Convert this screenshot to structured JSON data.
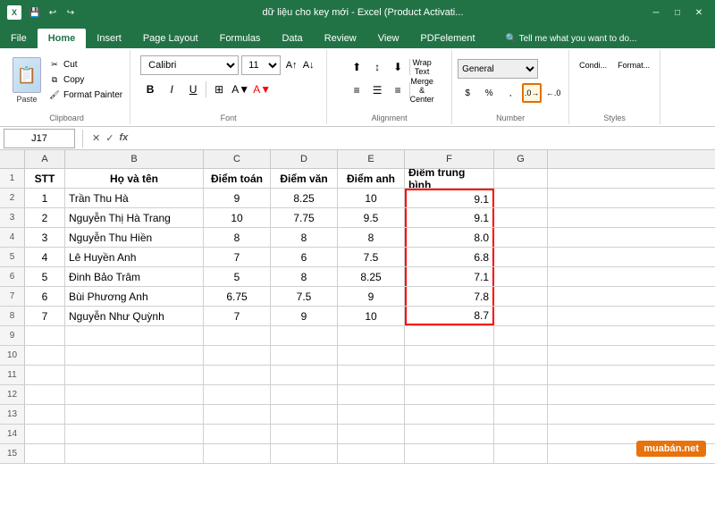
{
  "titlebar": {
    "title": "dữ liệu cho key mới - Excel (Product Activati...",
    "save_icon": "💾",
    "undo_icon": "↩",
    "redo_icon": "↪"
  },
  "ribbon": {
    "tabs": [
      "File",
      "Home",
      "Insert",
      "Page Layout",
      "Formulas",
      "Data",
      "Review",
      "View",
      "PDFelement"
    ],
    "active_tab": "Home",
    "clipboard_group": "Clipboard",
    "font_group": "Font",
    "alignment_group": "Alignment",
    "number_group": "Number",
    "styles_group": "Styles"
  },
  "toolbar": {
    "paste_label": "Paste",
    "cut_label": "Cut",
    "copy_label": "Copy",
    "format_painter_label": "Format Painter",
    "font_name": "Calibri",
    "font_size": "11",
    "wrap_text": "Wrap Text",
    "merge_center": "Merge & Center",
    "number_format": "General",
    "bold": "B",
    "italic": "I",
    "underline": "U"
  },
  "formula_bar": {
    "cell_ref": "J17",
    "formula": ""
  },
  "columns": {
    "headers": [
      "A",
      "B",
      "C",
      "D",
      "E",
      "F",
      "G"
    ]
  },
  "sheet": {
    "header_row": {
      "stt": "STT",
      "ho_va_ten": "Họ và tên",
      "diem_toan": "Điểm toán",
      "diem_van": "Điểm văn",
      "diem_anh": "Điểm anh",
      "diem_tb": "Điểm trung bình"
    },
    "rows": [
      {
        "num": 2,
        "stt": 1,
        "name": "Trần Thu Hà",
        "toan": 9,
        "van": 8.25,
        "anh": 10,
        "tb": 9.1
      },
      {
        "num": 3,
        "stt": 2,
        "name": "Nguyễn Thị Hà Trang",
        "toan": 10,
        "van": 7.75,
        "anh": 9.5,
        "tb": 9.1
      },
      {
        "num": 4,
        "stt": 3,
        "name": "Nguyễn Thu Hiền",
        "toan": 8,
        "van": 8,
        "anh": 8,
        "tb": 8.0
      },
      {
        "num": 5,
        "stt": 4,
        "name": "Lê Huyền Anh",
        "toan": 7,
        "van": 6,
        "anh": 7.5,
        "tb": 6.8
      },
      {
        "num": 6,
        "stt": 5,
        "name": "Đinh Bảo Trâm",
        "toan": 5,
        "van": 8,
        "anh": 8.25,
        "tb": 7.1
      },
      {
        "num": 7,
        "stt": 6,
        "name": "Bùi Phương Anh",
        "toan": 6.75,
        "van": 7.5,
        "anh": 9,
        "tb": 7.8
      },
      {
        "num": 8,
        "stt": 7,
        "name": "Nguyễn Như Quỳnh",
        "toan": 7,
        "van": 9,
        "anh": 10,
        "tb": 8.7
      }
    ],
    "empty_rows": [
      9,
      10,
      11,
      12,
      13,
      14,
      15
    ]
  },
  "watermark": "muabán.net"
}
